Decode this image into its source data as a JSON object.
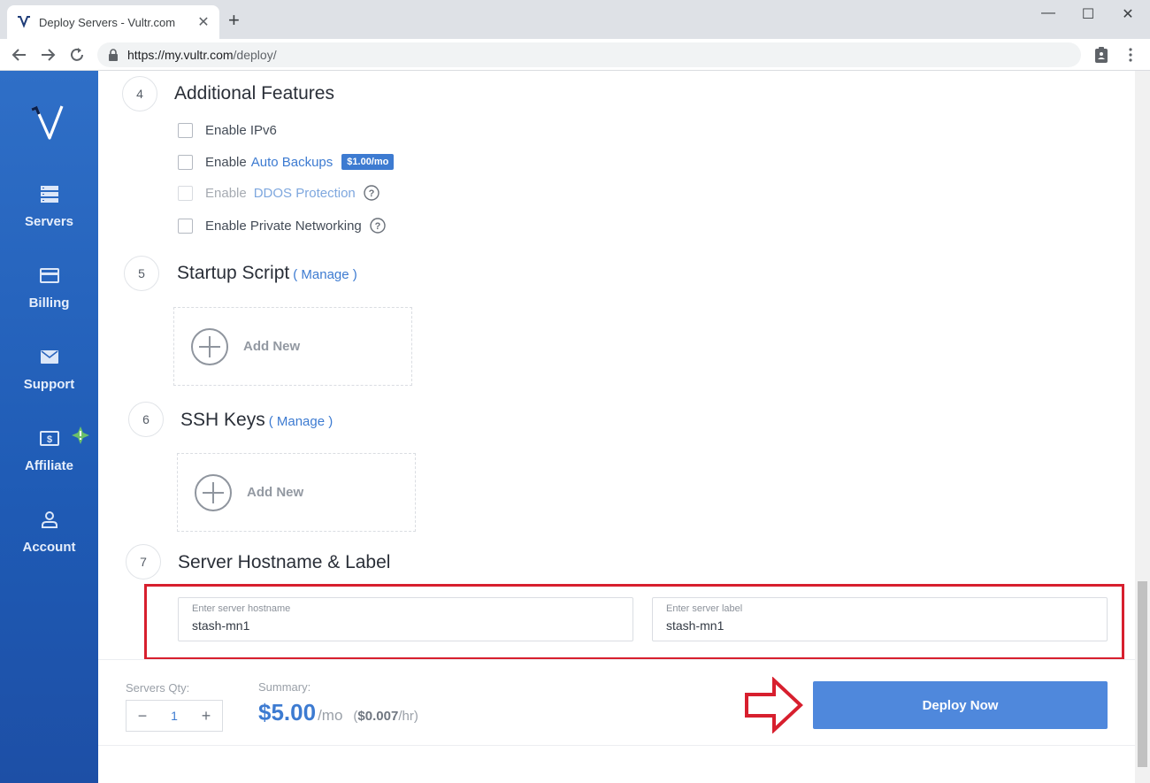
{
  "browser": {
    "tab_title": "Deploy Servers - Vultr.com",
    "tab_close": "✕",
    "new_tab": "+",
    "url_host": "https://my.vultr.com",
    "url_path": "/deploy/",
    "win_min": "—",
    "win_max": "☐",
    "win_close": "✕"
  },
  "sidebar": {
    "items": [
      {
        "label": "Servers",
        "icon": "servers-icon"
      },
      {
        "label": "Billing",
        "icon": "credit-card-icon"
      },
      {
        "label": "Support",
        "icon": "envelope-icon"
      },
      {
        "label": "Affiliate",
        "icon": "dollar-icon"
      },
      {
        "label": "Account",
        "icon": "user-icon"
      }
    ],
    "accent": "#2f6fc7"
  },
  "sections": {
    "features": {
      "number": "4",
      "title": "Additional Features",
      "options": [
        {
          "label": "Enable IPv6"
        },
        {
          "label": "Enable",
          "link": "Auto Backups",
          "badge": "$1.00/mo"
        },
        {
          "label": "Enable",
          "link": "DDOS Protection",
          "disabled": true
        },
        {
          "label": "Enable Private Networking"
        }
      ]
    },
    "startup": {
      "number": "5",
      "title": "Startup Script",
      "manage": "( Manage )",
      "add_new": "Add New"
    },
    "ssh": {
      "number": "6",
      "title": "SSH Keys",
      "manage": "( Manage )",
      "add_new": "Add New"
    },
    "hostname": {
      "number": "7",
      "title": "Server Hostname & Label",
      "hostname_label": "Enter server hostname",
      "hostname_value": "stash-mn1",
      "label_label": "Enter server label",
      "label_value": "stash-mn1"
    }
  },
  "footer": {
    "qty_label": "Servers Qty:",
    "qty_minus": "−",
    "qty_value": "1",
    "qty_plus": "+",
    "summary_label": "Summary:",
    "price": "$5.00",
    "per": "/mo",
    "hourly_open": "(",
    "hourly_price": "$0.007",
    "hourly_per": "/hr)",
    "deploy_label": "Deploy Now"
  },
  "colors": {
    "accent": "#3d7bd1",
    "deploy": "#4f88dc",
    "highlight": "#d71f2e"
  }
}
